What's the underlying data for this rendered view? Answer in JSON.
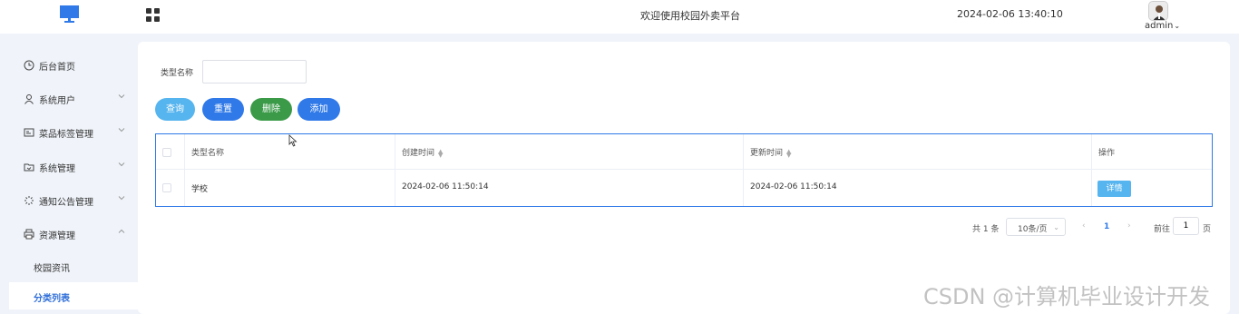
{
  "header": {
    "welcome": "欢迎使用校园外卖平台",
    "datetime": "2024-02-06 13:40:10",
    "username": "admin",
    "logo_icon": "monitor-icon",
    "menu_toggle_icon": "grid-icon",
    "accent": "#2f79e8"
  },
  "sidebar": {
    "items": [
      {
        "label": "后台首页",
        "icon": "clock-icon"
      },
      {
        "label": "系统用户",
        "icon": "user-icon"
      },
      {
        "label": "菜品标签管理",
        "icon": "tag-icon"
      },
      {
        "label": "系统管理",
        "icon": "folder-icon"
      },
      {
        "label": "通知公告管理",
        "icon": "loading-icon"
      },
      {
        "label": "资源管理",
        "icon": "printer-icon"
      }
    ],
    "subitems": [
      {
        "label": "校园资讯"
      },
      {
        "label": "分类列表"
      }
    ]
  },
  "search": {
    "label": "类型名称",
    "value": ""
  },
  "buttons": {
    "query": "查询",
    "reset": "重置",
    "delete": "删除",
    "add": "添加"
  },
  "table": {
    "headers": [
      "类型名称",
      "创建时间",
      "更新时间",
      "操作"
    ],
    "rows": [
      {
        "name": "学校",
        "created": "2024-02-06 11:50:14",
        "updated": "2024-02-06 11:50:14",
        "action": "详情"
      }
    ]
  },
  "pagination": {
    "total": "共 1 条",
    "page_size": "10条/页",
    "prev": "‹",
    "current": "1",
    "next": "›",
    "goto_label": "前往",
    "goto_value": "1",
    "page_suffix": "页"
  },
  "watermark": "CSDN @计算机毕业设计开发"
}
